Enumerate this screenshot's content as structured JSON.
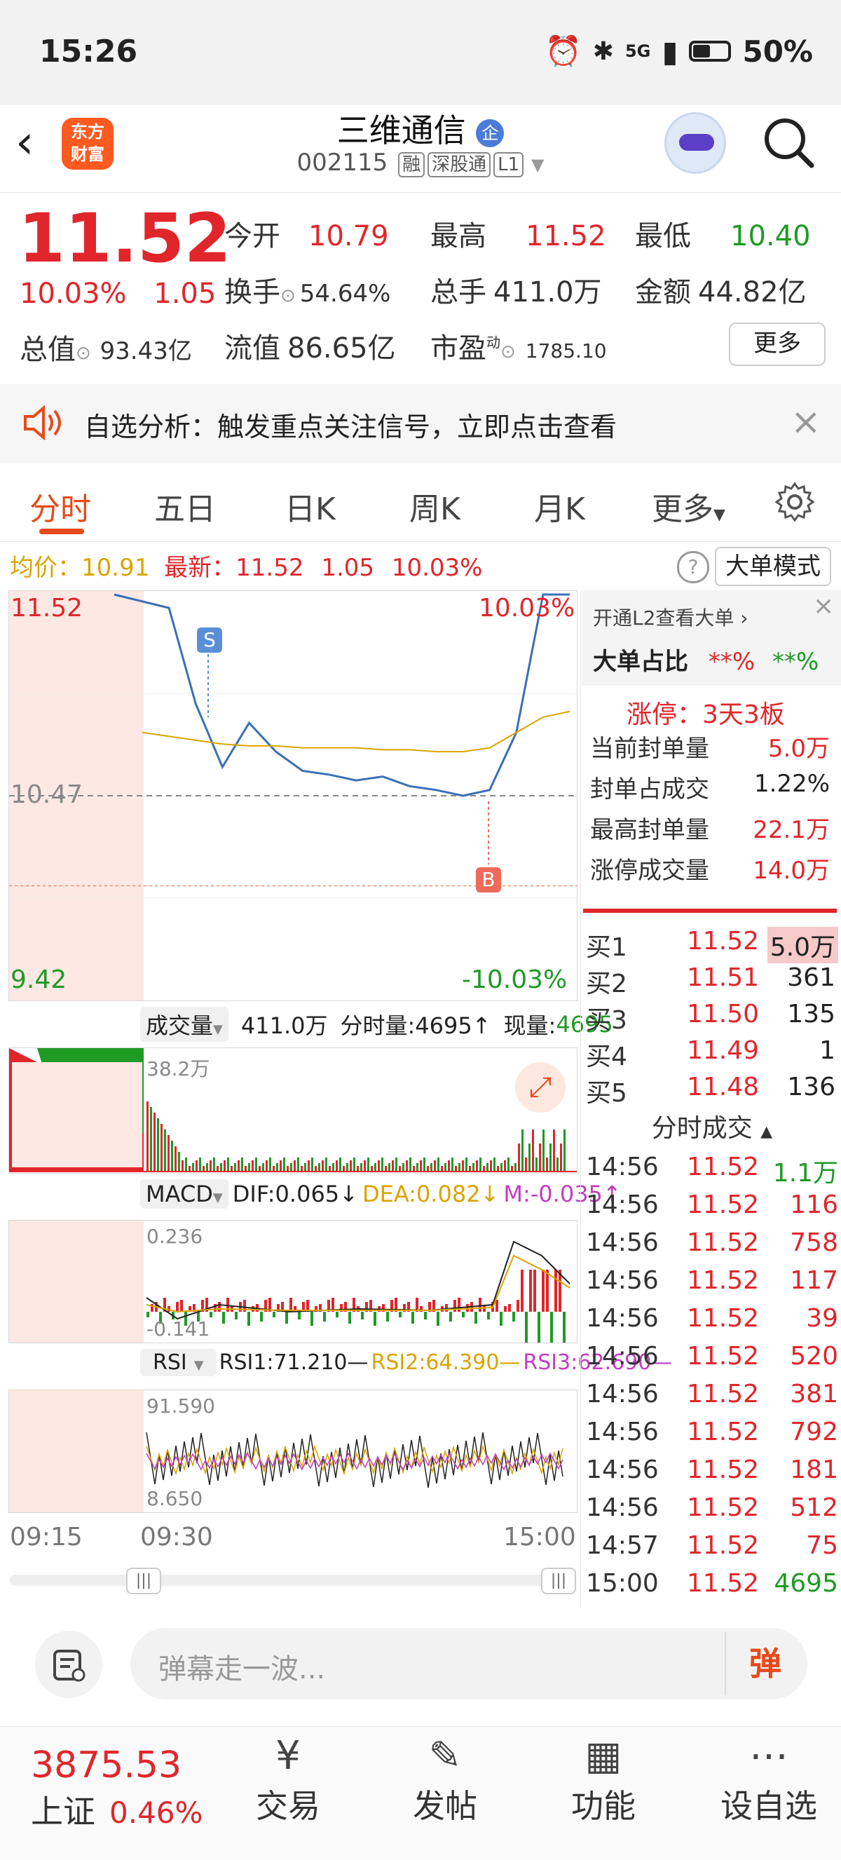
{
  "status_bar": {
    "time": "15:26",
    "network": "5G",
    "battery": "50%"
  },
  "header": {
    "back_icon": "chevron-left-icon",
    "logo": "东方\n财富",
    "title": "三维通信",
    "title_badge": "企",
    "code": "002115",
    "tags": [
      "融",
      "深股通",
      "L1"
    ],
    "search_icon": "search-icon"
  },
  "quote": {
    "price": "11.52",
    "change_pct": "10.03%",
    "change": "1.05",
    "open_label": "今开",
    "open": "10.79",
    "high_label": "最高",
    "high": "11.52",
    "low_label": "最低",
    "low": "10.40",
    "turnover_label": "换手",
    "turnover": "54.64%",
    "volume_label": "总手",
    "volume": "411.0万",
    "amount_label": "金额",
    "amount": "44.82亿",
    "total_value_label": "总值",
    "total_value": "93.43亿",
    "float_value_label": "流值",
    "float_value": "86.65亿",
    "pe_label": "市盈",
    "pe_super": "动",
    "pe": "1785.10",
    "more_button": "更多"
  },
  "notice": {
    "text": "自选分析：触发重点关注信号，立即点击查看"
  },
  "tabs": [
    "分时",
    "五日",
    "日K",
    "周K",
    "月K",
    "更多"
  ],
  "info_line": {
    "avg_label": "均价：",
    "avg": "10.91",
    "latest_label": "最新：",
    "latest": "11.52",
    "change": "1.05",
    "pct": "10.03%",
    "big_order_mode": "大单模式"
  },
  "chart": {
    "price_top": "11.52",
    "price_mid": "10.47",
    "price_bottom": "9.42",
    "pct_top": "10.03%",
    "pct_bottom": "-10.03%",
    "marker_s": "S",
    "marker_b": "B",
    "volume_label": "成交量",
    "volume_total": "411.0万",
    "volume_time": "分时量:4695↑",
    "volume_now_label": "现量:",
    "volume_now": "4695",
    "volume_scale": "38.2万",
    "macd_label": "MACD",
    "macd_dif": "DIF:0.065↓",
    "macd_dea": "DEA:0.082↓",
    "macd_m": "M:-0.035↑",
    "macd_scale_top": "0.236",
    "macd_scale_bottom": "-0.141",
    "rsi_label": "RSI",
    "rsi1": "RSI1:71.210—",
    "rsi2": "RSI2:64.390—",
    "rsi3": "RSI3:62.690—",
    "rsi_scale_top": "91.590",
    "rsi_scale_bottom": "8.650",
    "time_axis": [
      "09:15",
      "09:30",
      "15:00"
    ]
  },
  "chart_data": {
    "type": "line",
    "x_range": [
      "09:15",
      "15:00"
    ],
    "ylim": [
      9.42,
      11.52
    ],
    "series": [
      {
        "values": [
          11.52,
          11.45,
          10.95,
          10.62,
          10.85,
          10.7,
          10.6,
          10.58,
          10.55,
          10.57,
          10.52,
          10.5,
          10.47,
          10.5,
          10.8,
          11.52,
          11.52
        ]
      },
      {
        "values": [
          10.8,
          10.78,
          10.76,
          10.74,
          10.73,
          10.73,
          10.72,
          10.72,
          10.72,
          10.71,
          10.71,
          10.7,
          10.7,
          10.72,
          10.8,
          10.88,
          10.91
        ]
      }
    ]
  },
  "right_panel": {
    "l2_link": "开通L2查看大单",
    "big_ratio_label": "大单占比",
    "big_ratio_red": "**%",
    "big_ratio_green": "**%",
    "limit_up": "涨停：3天3板",
    "stats": [
      {
        "label": "当前封单量",
        "value": "5.0万"
      },
      {
        "label": "封单占成交",
        "value": "1.22%"
      },
      {
        "label": "最高封单量",
        "value": "22.1万"
      },
      {
        "label": "涨停成交量",
        "value": "14.0万"
      }
    ],
    "bids": [
      {
        "label": "买1",
        "price": "11.52",
        "vol": "5.0万"
      },
      {
        "label": "买2",
        "price": "11.51",
        "vol": "361"
      },
      {
        "label": "买3",
        "price": "11.50",
        "vol": "135"
      },
      {
        "label": "买4",
        "price": "11.49",
        "vol": "1"
      },
      {
        "label": "买5",
        "price": "11.48",
        "vol": "136"
      }
    ],
    "trades_title": "分时成交",
    "trades": [
      {
        "time": "14:56",
        "price": "11.52",
        "vol": "1.1万",
        "color": "green"
      },
      {
        "time": "14:56",
        "price": "11.52",
        "vol": "116",
        "color": "red"
      },
      {
        "time": "14:56",
        "price": "11.52",
        "vol": "758",
        "color": "red"
      },
      {
        "time": "14:56",
        "price": "11.52",
        "vol": "117",
        "color": "red"
      },
      {
        "time": "14:56",
        "price": "11.52",
        "vol": "39",
        "color": "red"
      },
      {
        "time": "14:56",
        "price": "11.52",
        "vol": "520",
        "color": "red"
      },
      {
        "time": "14:56",
        "price": "11.52",
        "vol": "381",
        "color": "red"
      },
      {
        "time": "14:56",
        "price": "11.52",
        "vol": "792",
        "color": "red"
      },
      {
        "time": "14:56",
        "price": "11.52",
        "vol": "181",
        "color": "red"
      },
      {
        "time": "14:56",
        "price": "11.52",
        "vol": "512",
        "color": "red"
      },
      {
        "time": "14:57",
        "price": "11.52",
        "vol": "75",
        "color": "red"
      },
      {
        "time": "15:00",
        "price": "11.52",
        "vol": "4695",
        "color": "green"
      }
    ]
  },
  "comment": {
    "placeholder": "弹幕走一波...",
    "danmu_label": "弹"
  },
  "bottom_nav": {
    "index_value": "3875.53",
    "index_name": "上证",
    "index_pct": "0.46%",
    "items": [
      "交易",
      "发帖",
      "功能",
      "设自选"
    ]
  },
  "colors": {
    "up": "#e0262b",
    "down": "#1f9a25",
    "accent": "#e64a19",
    "avg_line": "#d9a400"
  }
}
